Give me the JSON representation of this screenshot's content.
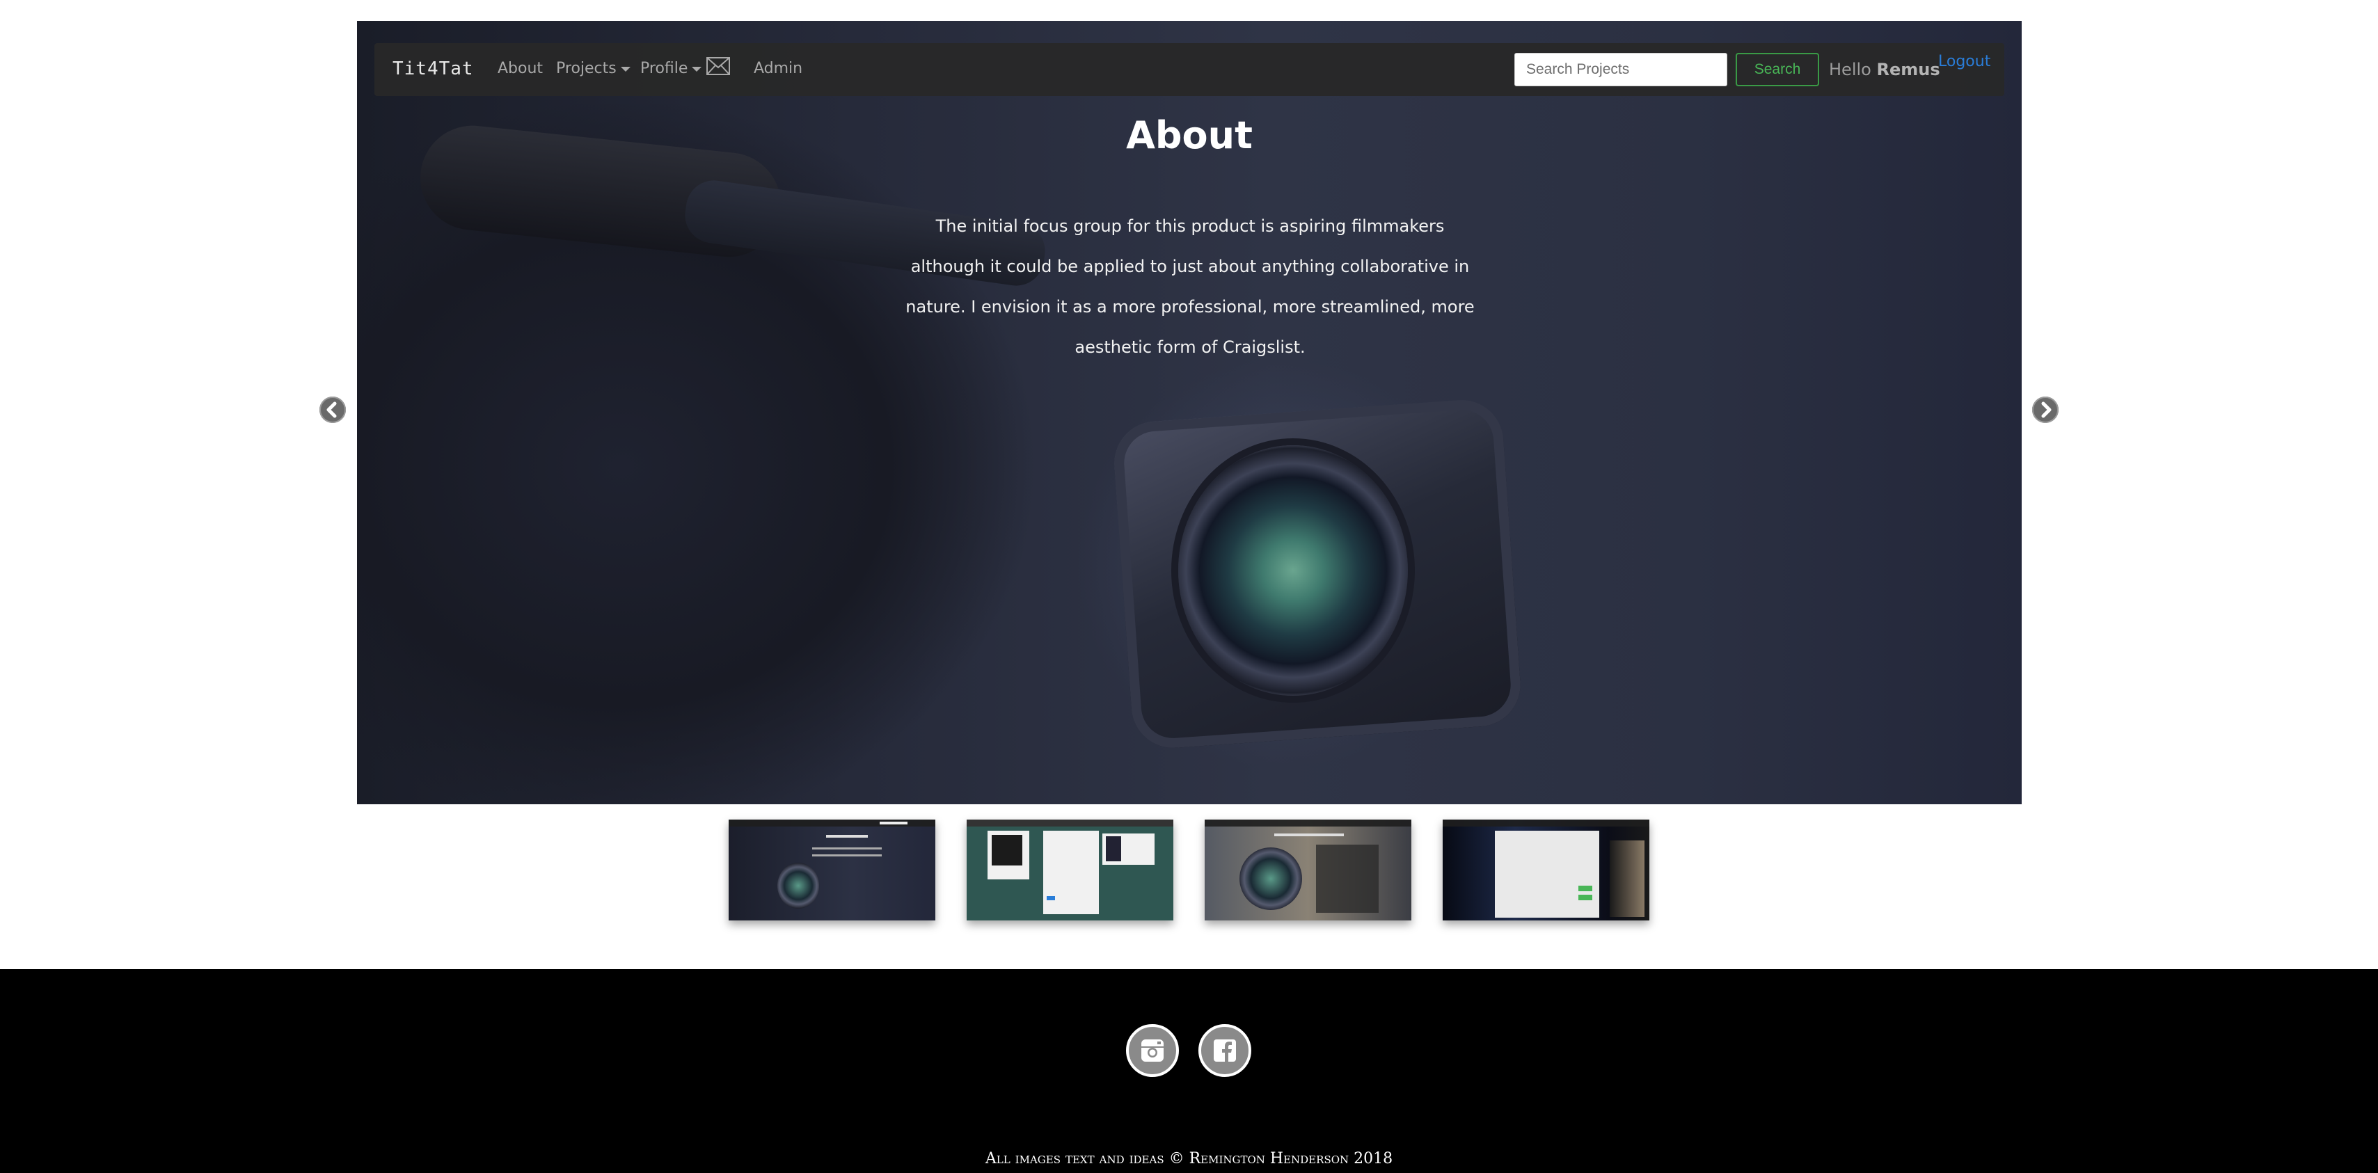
{
  "navbar": {
    "brand": "Tit4Tat",
    "links": {
      "about": "About",
      "projects": "Projects",
      "profile": "Profile",
      "admin": "Admin"
    },
    "mail_icon": "envelope-icon",
    "search_placeholder": "Search Projects",
    "search_button": "Search",
    "greeting": "Hello",
    "username": "Remus",
    "logout": "Logout"
  },
  "carousel": {
    "title": "About",
    "body": "The initial focus group for this product is aspiring filmmakers although it could be applied to just about anything collaborative in nature. I envision it as a more professional, more streamlined, more aesthetic form of Craigslist.",
    "prev_icon": "chevron-left-circle-icon",
    "next_icon": "chevron-right-circle-icon",
    "thumbnail_count": 4
  },
  "footer": {
    "social": [
      "instagram-icon",
      "facebook-icon"
    ],
    "copyright": "All images text and ideas © Remington Henderson 2018"
  },
  "colors": {
    "navbar_bg": "#282828",
    "search_green": "#49b657",
    "logout_blue": "#2a7dd8",
    "footer_bg": "#000000"
  }
}
